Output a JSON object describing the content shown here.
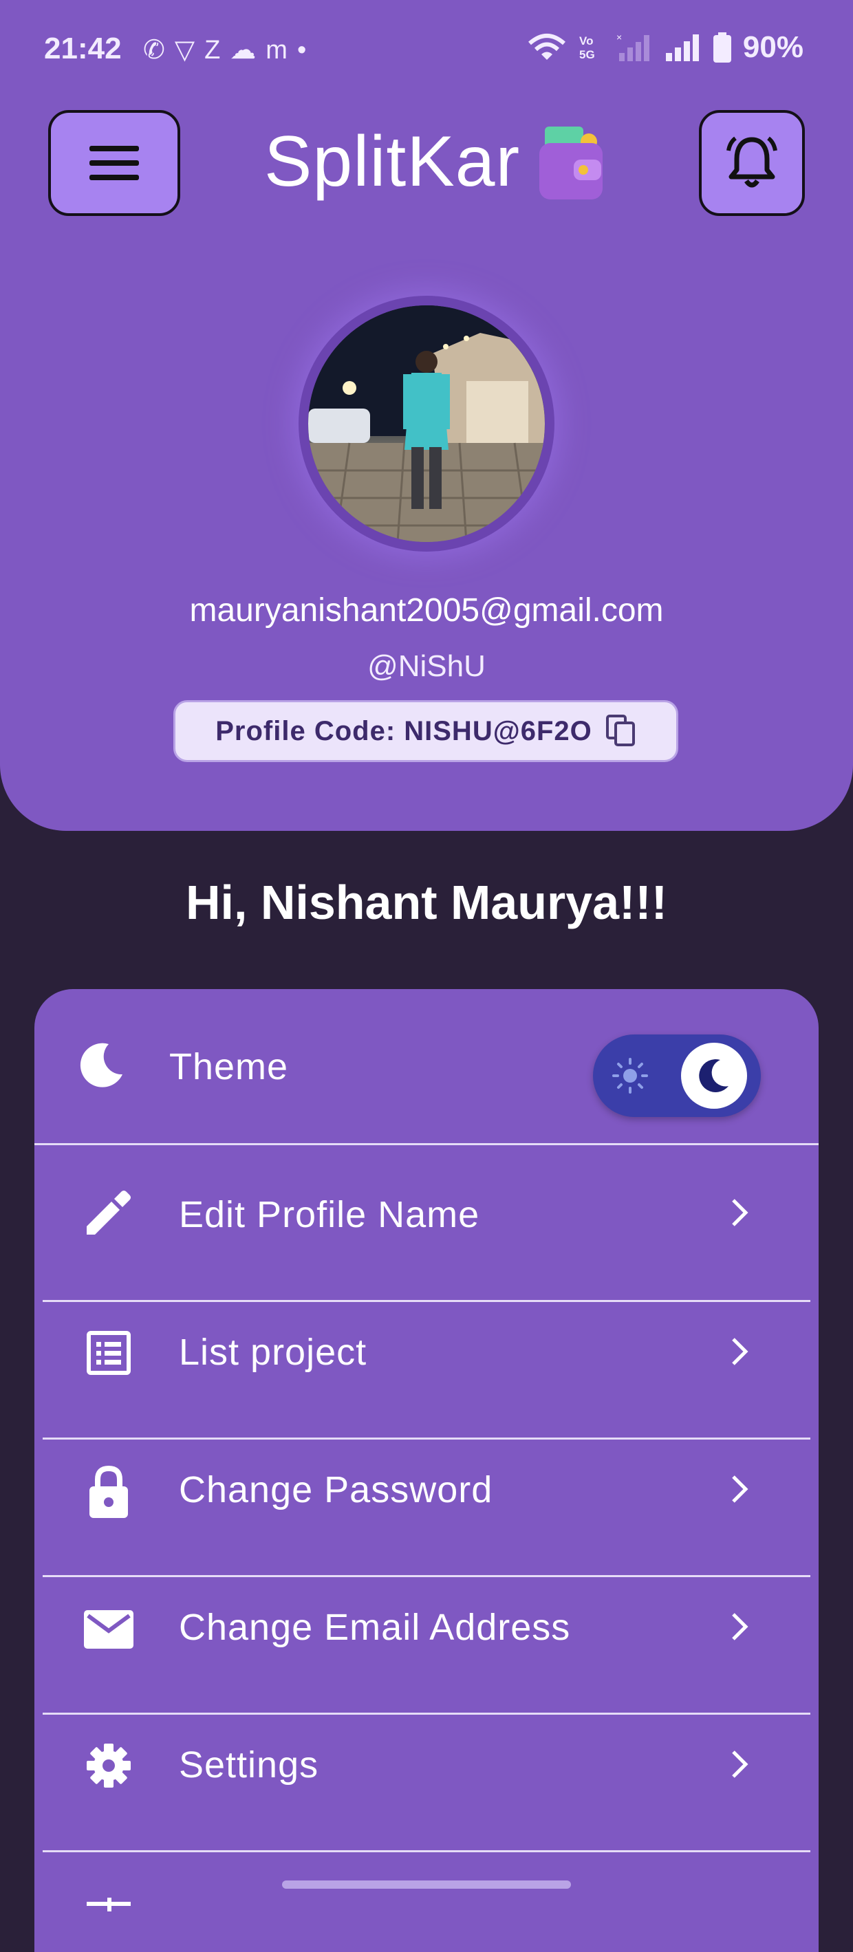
{
  "status_bar": {
    "time": "21:42",
    "battery": "90%",
    "left_icons": [
      "whatsapp-icon",
      "vpn-shield-icon",
      "zomato-z-icon",
      "piggy-icon",
      "m-app-icon",
      "dot-icon"
    ],
    "right_icons": [
      "wifi-icon",
      "volte-icon",
      "signal-off-icon",
      "signal-icon",
      "battery-icon"
    ]
  },
  "app_bar": {
    "title": "SplitKar",
    "menu_icon": "hamburger-menu-icon",
    "bell_icon": "notification-bell-icon",
    "logo_icon": "wallet-icon"
  },
  "profile": {
    "email": "mauryanishant2005@gmail.com",
    "handle": "@NiShU",
    "code_label": "Profile Code: NISHU@6F2O",
    "copy_icon": "copy-icon"
  },
  "greeting": "Hi, Nishant Maurya!!!",
  "menu": {
    "theme": {
      "label": "Theme",
      "icon": "moon-icon",
      "toggle_state": "dark"
    },
    "items": [
      {
        "label": "Edit Profile Name",
        "icon": "pencil-icon"
      },
      {
        "label": "List project",
        "icon": "list-icon"
      },
      {
        "label": "Change Password",
        "icon": "lock-icon"
      },
      {
        "label": "Change Email Address",
        "icon": "mail-icon"
      },
      {
        "label": "Settings",
        "icon": "gear-icon"
      }
    ]
  },
  "colors": {
    "header": "#7f58c2",
    "background": "#2a2039",
    "button_fill": "#a783f0",
    "toggle_track": "#3b3ea9"
  }
}
